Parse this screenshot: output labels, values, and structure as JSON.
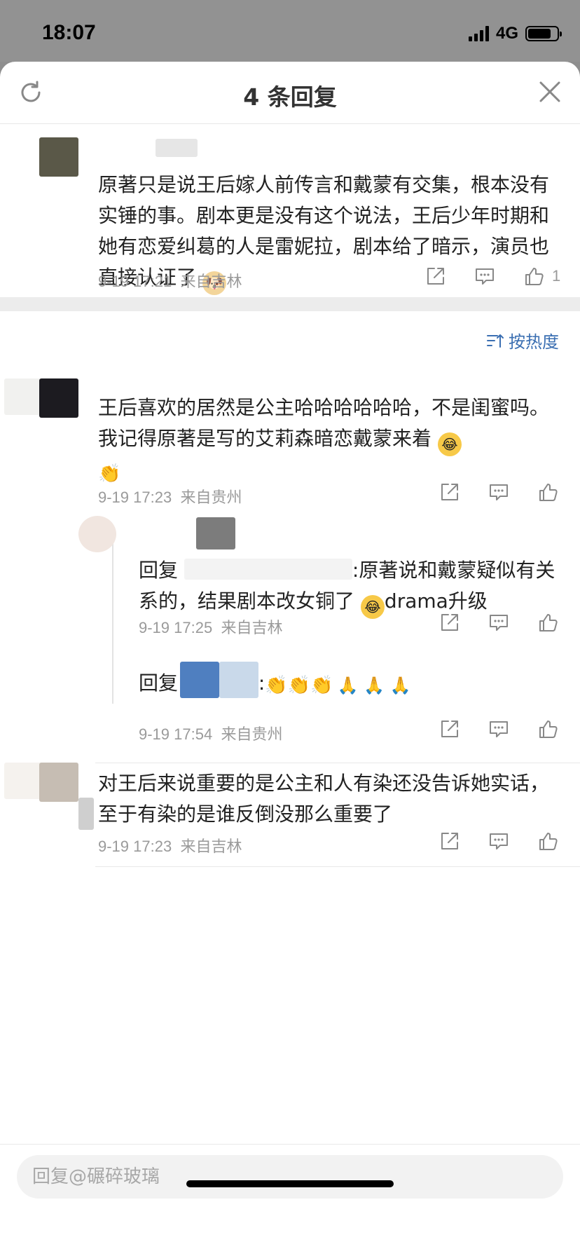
{
  "status": {
    "time": "18:07",
    "network": "4G"
  },
  "header": {
    "title": "4 条回复"
  },
  "root_comment": {
    "text": "原著只是说王后嫁人前传言和戴蒙有交集，根本没有实锤的事。剧本更是没有这个说法，王后少年时期和她有恋爱纠葛的人是雷妮拉，剧本给了暗示，演员也直接认证了",
    "emoji": "doge-emoji",
    "time": "9-19 17:21",
    "location": "来自吉林",
    "likes": "1"
  },
  "sort": {
    "label": "按热度"
  },
  "replies": [
    {
      "text": "王后喜欢的居然是公主哈哈哈哈哈哈，不是闺蜜吗。我记得原著是写的艾莉森暗恋戴蒙来着",
      "emoji1": "laugh-cry-emoji",
      "emoji2": "clap-emoji",
      "time": "9-19 17:23",
      "location": "来自贵州",
      "sub_replies": [
        {
          "prefix": "回复",
          "text": ":原著说和戴蒙疑似有关系的，结果剧本改女铜了",
          "suffix": "drama升级",
          "time": "9-19 17:25",
          "location": "来自吉林"
        },
        {
          "prefix": "回复",
          "text": ":",
          "time": "9-19 17:54",
          "location": "来自贵州"
        }
      ]
    },
    {
      "text": "对王后来说重要的是公主和人有染还没告诉她实话，至于有染的是谁反倒没那么重要了",
      "time": "9-19 17:23",
      "location": "来自吉林"
    }
  ],
  "input": {
    "placeholder": "回复@碾碎玻璃"
  },
  "colors": {
    "accent": "#3b6fb2",
    "meta": "#9a9a9a",
    "divider": "#ececec"
  }
}
